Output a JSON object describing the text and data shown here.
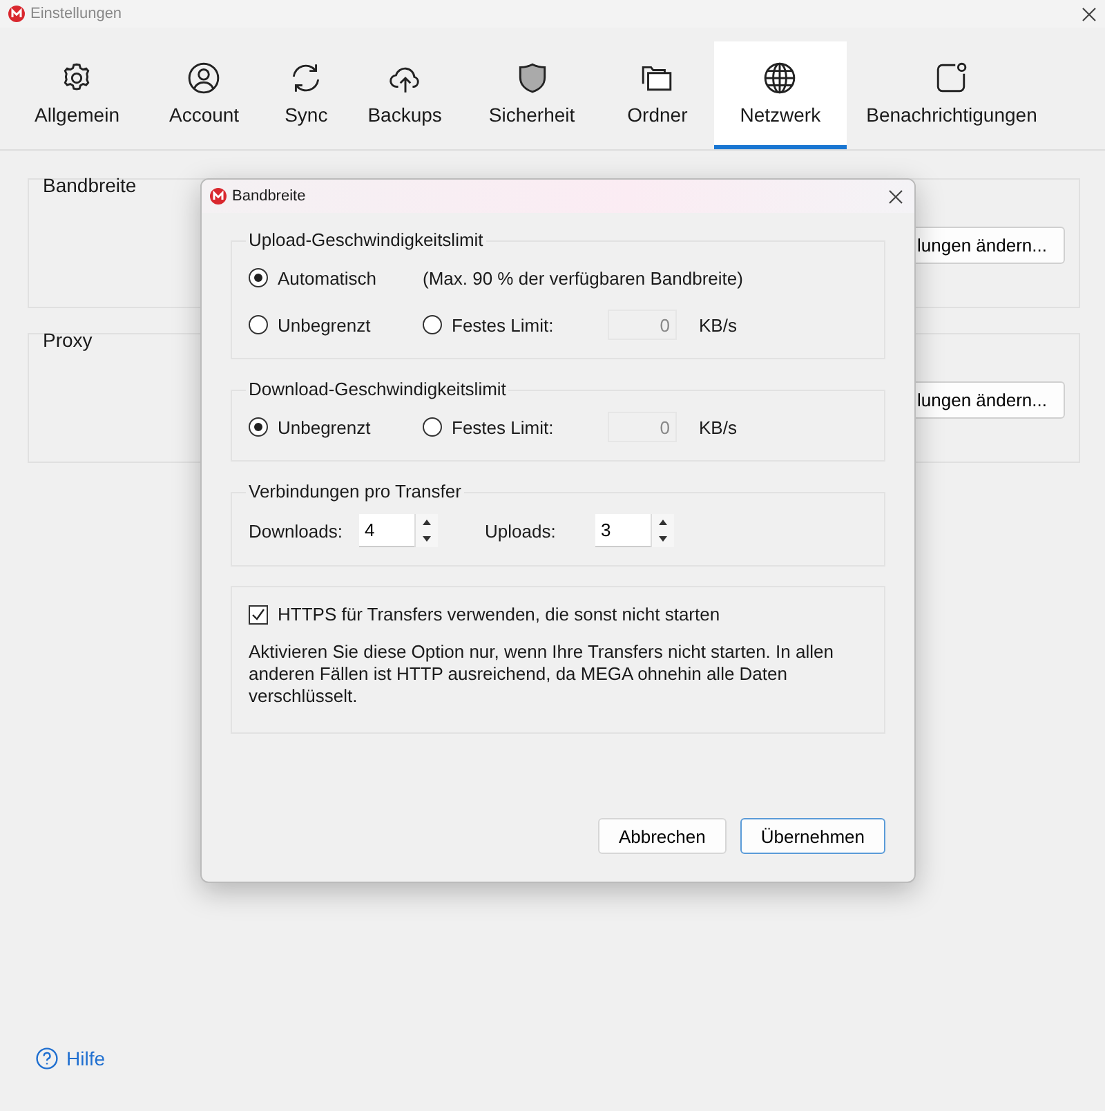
{
  "window": {
    "title": "Einstellungen"
  },
  "tabs": [
    {
      "label": "Allgemein",
      "selected": false
    },
    {
      "label": "Account",
      "selected": false
    },
    {
      "label": "Sync",
      "selected": false
    },
    {
      "label": "Backups",
      "selected": false
    },
    {
      "label": "Sicherheit",
      "selected": false
    },
    {
      "label": "Ordner",
      "selected": false
    },
    {
      "label": "Netzwerk",
      "selected": true
    },
    {
      "label": "Benachrichtigungen",
      "selected": false
    }
  ],
  "sections": [
    {
      "title": "Bandbreite",
      "button": "lungen ändern..."
    },
    {
      "title": "Proxy",
      "button": "lungen ändern..."
    }
  ],
  "help_link": "Hilfe",
  "dialog": {
    "title": "Bandbreite",
    "upload": {
      "title": "Upload-Geschwindigkeitslimit",
      "note": "(Max. 90 % der verfügbaren Bandbreite)",
      "options": [
        {
          "label": "Automatisch",
          "selected": true
        },
        {
          "label": "Unbegrenzt",
          "selected": false
        },
        {
          "label": "Festes Limit:",
          "selected": false
        }
      ],
      "limit_value": "0",
      "limit_disabled": true,
      "unit": "KB/s"
    },
    "download": {
      "title": "Download-Geschwindigkeitslimit",
      "options": [
        {
          "label": "Unbegrenzt",
          "selected": true
        },
        {
          "label": "Festes Limit:",
          "selected": false
        }
      ],
      "limit_value": "0",
      "limit_disabled": true,
      "unit": "KB/s"
    },
    "connections": {
      "title": "Verbindungen pro Transfer",
      "fields": [
        {
          "label": "Downloads:",
          "value": "4"
        },
        {
          "label": "Uploads:",
          "value": "3"
        }
      ]
    },
    "https": {
      "label": "HTTPS für Transfers verwenden, die sonst nicht starten",
      "checked": true,
      "description": "Aktivieren Sie diese Option nur, wenn Ihre Transfers nicht starten. In allen anderen Fällen ist HTTP ausreichend, da MEGA ohnehin alle Daten verschlüsselt."
    },
    "buttons": [
      {
        "label": "Abbrechen",
        "default": false
      },
      {
        "label": "Übernehmen",
        "default": true
      }
    ]
  }
}
